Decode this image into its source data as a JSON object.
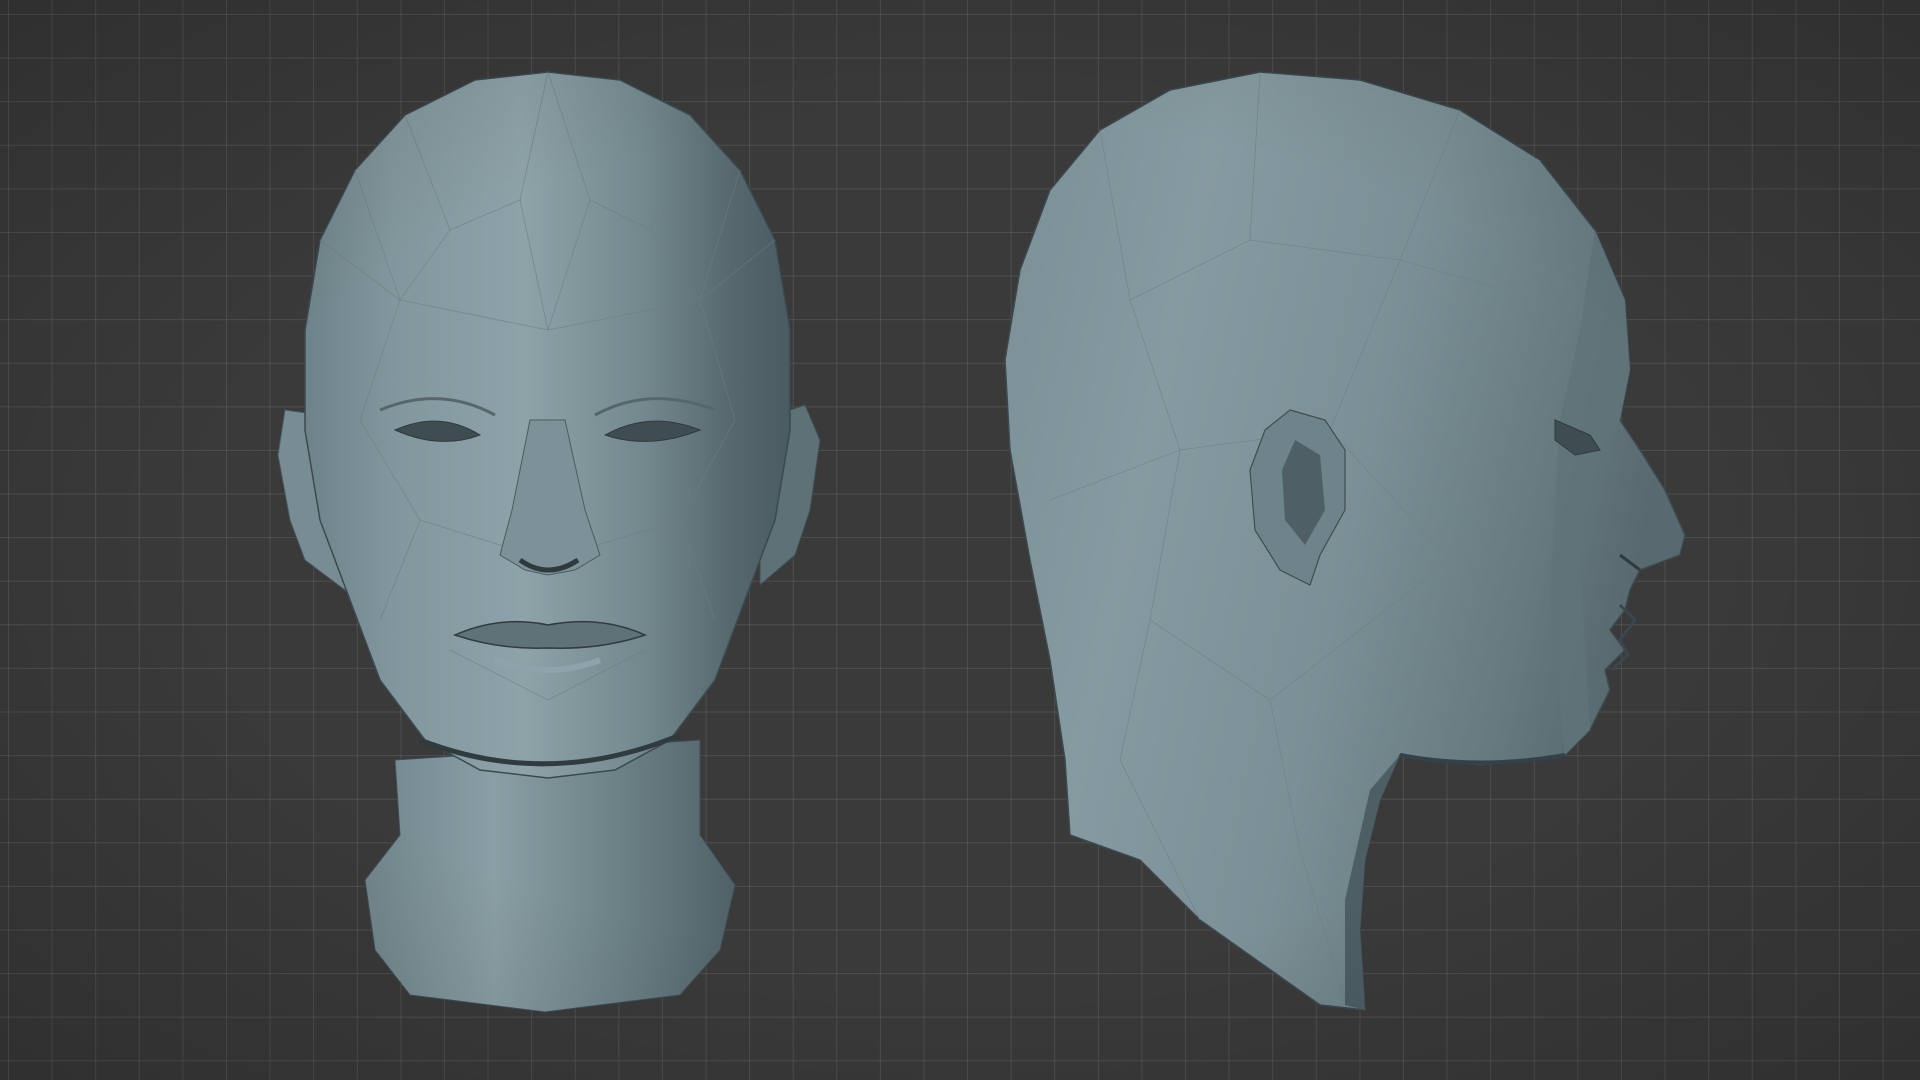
{
  "viewport": {
    "background": "#3a3a3a",
    "grid": true,
    "grid_color": "#5a5a5a"
  },
  "models": [
    {
      "name": "head-front-view",
      "view": "front",
      "material_color": "#7f9399"
    },
    {
      "name": "head-side-view",
      "view": "right-profile",
      "material_color": "#7f9399"
    }
  ]
}
